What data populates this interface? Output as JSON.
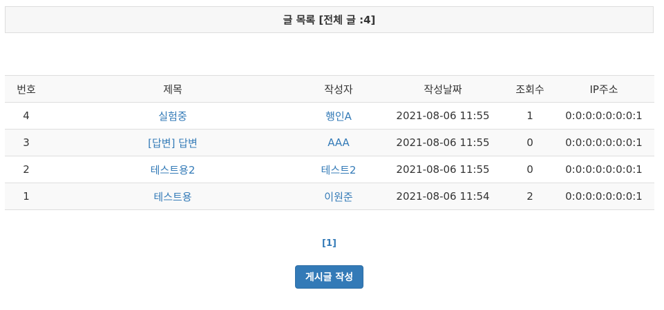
{
  "header": {
    "title": "글 목록 [전체 글 :4]"
  },
  "table": {
    "columns": [
      "번호",
      "제목",
      "작성자",
      "작성날짜",
      "조회수",
      "IP주소"
    ],
    "rows": [
      {
        "num": "4",
        "subject": "실험중",
        "writer": "행인A",
        "date": "2021-08-06 11:55",
        "views": "1",
        "ip": "0:0:0:0:0:0:0:1"
      },
      {
        "num": "3",
        "subject": "[답변] 답변",
        "writer": "AAA",
        "date": "2021-08-06 11:55",
        "views": "0",
        "ip": "0:0:0:0:0:0:0:1"
      },
      {
        "num": "2",
        "subject": "테스트용2",
        "writer": "테스트2",
        "date": "2021-08-06 11:55",
        "views": "0",
        "ip": "0:0:0:0:0:0:0:1"
      },
      {
        "num": "1",
        "subject": "테스트용",
        "writer": "이원준",
        "date": "2021-08-06 11:54",
        "views": "2",
        "ip": "0:0:0:0:0:0:0:1"
      }
    ]
  },
  "pagination": {
    "pages": [
      "[1]"
    ]
  },
  "actions": {
    "write_label": "게시글 작성"
  },
  "colors": {
    "link": "#337ab7",
    "button_bg": "#337ab7",
    "header_bg": "#f7f7f7",
    "stripe_bg": "#f9f9f9",
    "border": "#dddddd"
  }
}
